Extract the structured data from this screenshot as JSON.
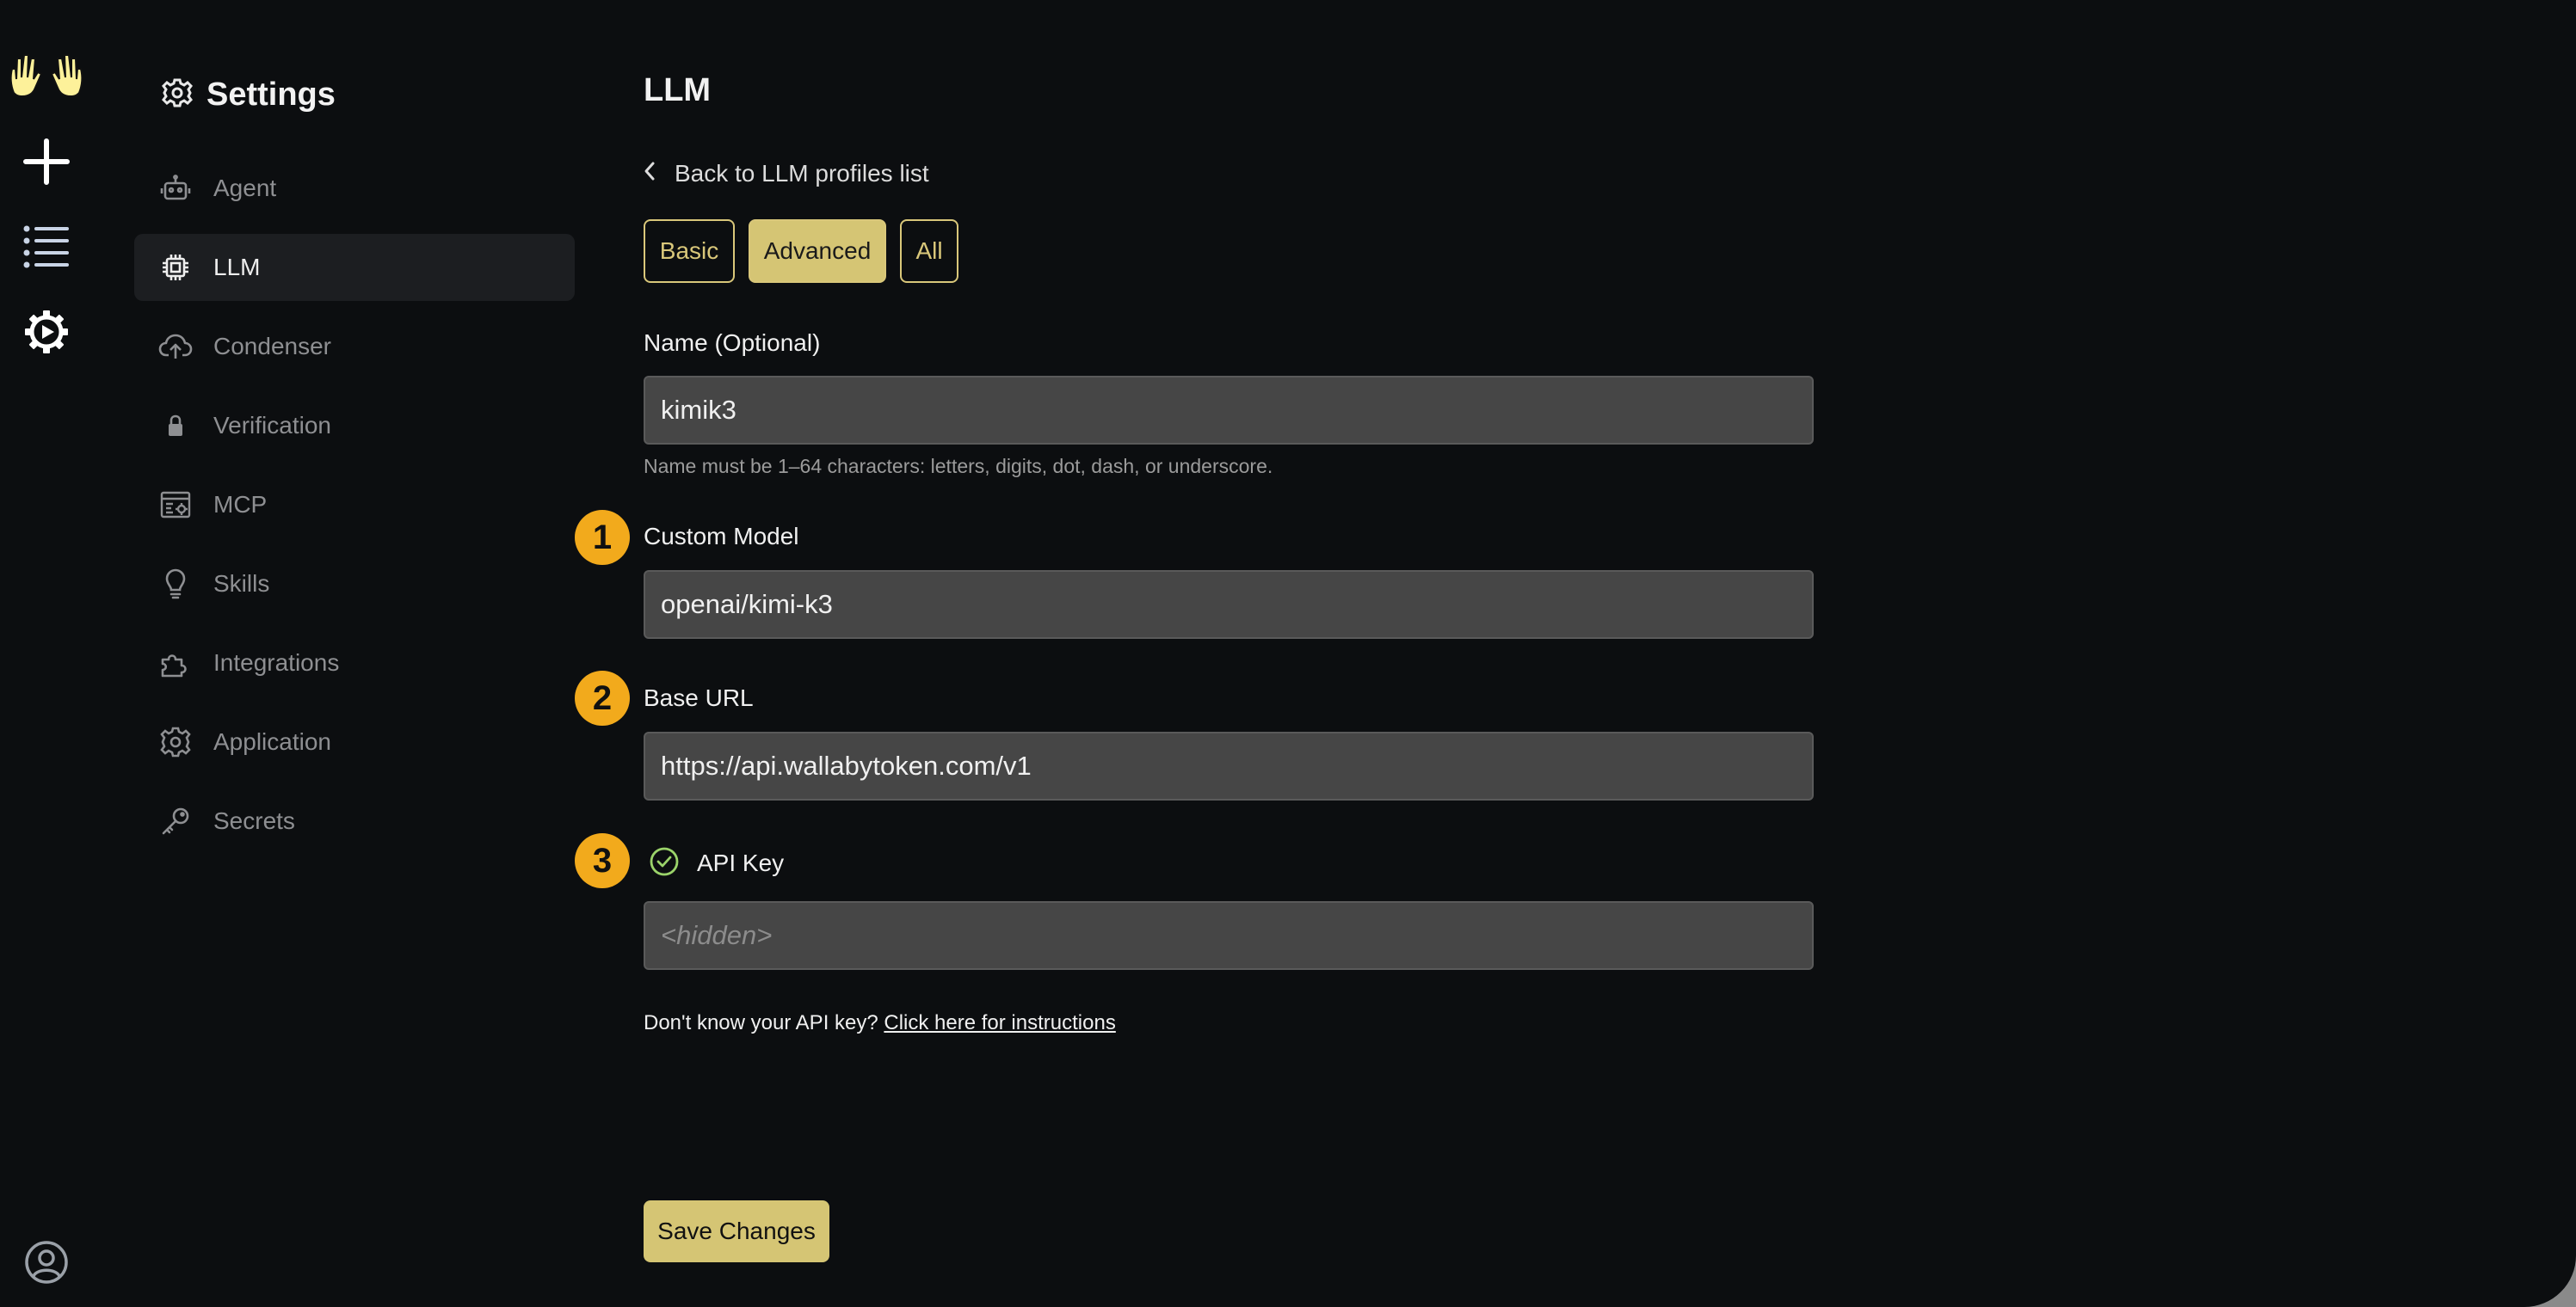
{
  "rail": {
    "icons": [
      "hands-logo-icon",
      "new-conversation-icon",
      "conversations-list-icon",
      "settings-icon",
      "user-profile-icon"
    ]
  },
  "nav": {
    "title": "Settings",
    "items": [
      {
        "label": "Agent",
        "icon": "robot-icon"
      },
      {
        "label": "LLM",
        "icon": "cpu-chip-icon",
        "active": true
      },
      {
        "label": "Condenser",
        "icon": "cloud-upload-icon"
      },
      {
        "label": "Verification",
        "icon": "lock-icon"
      },
      {
        "label": "MCP",
        "icon": "server-config-icon"
      },
      {
        "label": "Skills",
        "icon": "lightbulb-icon"
      },
      {
        "label": "Integrations",
        "icon": "puzzle-icon"
      },
      {
        "label": "Application",
        "icon": "gear-icon"
      },
      {
        "label": "Secrets",
        "icon": "key-icon"
      }
    ]
  },
  "main": {
    "title": "LLM",
    "back_label": "Back to LLM profiles list",
    "tabs": [
      {
        "label": "Basic",
        "active": false
      },
      {
        "label": "Advanced",
        "active": true
      },
      {
        "label": "All",
        "active": false
      }
    ],
    "name_field": {
      "label": "Name (Optional)",
      "value": "kimik3",
      "hint": "Name must be 1–64 characters: letters, digits, dot, dash, or underscore."
    },
    "model_field": {
      "badge": "1",
      "label": "Custom Model",
      "value": "openai/kimi-k3"
    },
    "base_url_field": {
      "badge": "2",
      "label": "Base URL",
      "value": "https://api.wallabytoken.com/v1"
    },
    "api_key_field": {
      "badge": "3",
      "label": "API Key",
      "placeholder": "<hidden>",
      "status_icon": "check-circle-icon"
    },
    "help_text": "Don't know your API key?",
    "help_link": "Click here for instructions",
    "save_label": "Save Changes"
  },
  "colors": {
    "background": "#0c0e10",
    "accent": "#d5c574",
    "badge": "#f2aa1c",
    "input_bg": "#464646",
    "success": "#9bd36a"
  }
}
